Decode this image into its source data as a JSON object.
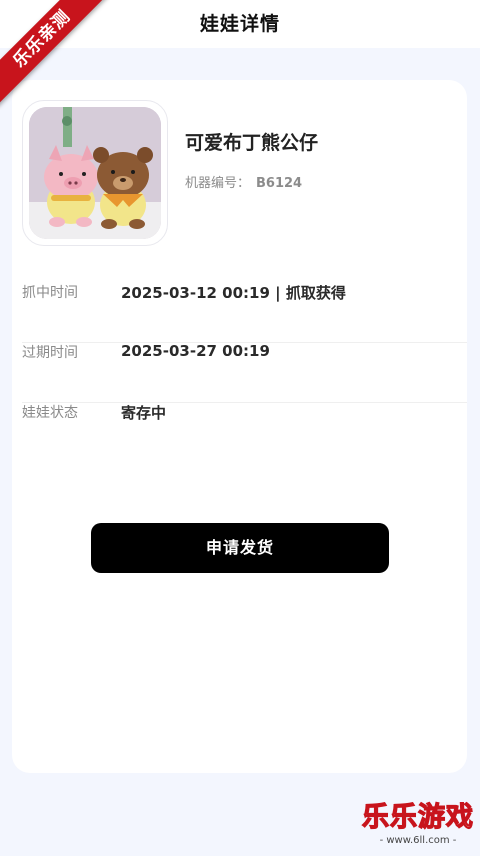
{
  "header": {
    "title": "娃娃详情"
  },
  "ribbon": {
    "text": "乐乐亲测"
  },
  "product": {
    "name": "可爱布丁熊公仔",
    "machine_label": "机器编号：",
    "machine_value": "B6124",
    "image_icon": "plush-toys-photo"
  },
  "details": [
    {
      "label": "抓中时间",
      "value": "2025-03-12 00:19 | 抓取获得"
    },
    {
      "label": "过期时间",
      "value": "2025-03-27 00:19"
    },
    {
      "label": "娃娃状态",
      "value": "寄存中"
    }
  ],
  "action": {
    "ship_label": "申请发货"
  },
  "watermark": {
    "main": "乐乐游戏",
    "sub": "- www.6ll.com -"
  },
  "colors": {
    "page_bg": "#f3f6fe",
    "button_bg": "#000000",
    "ribbon_red": "#c8141c"
  }
}
